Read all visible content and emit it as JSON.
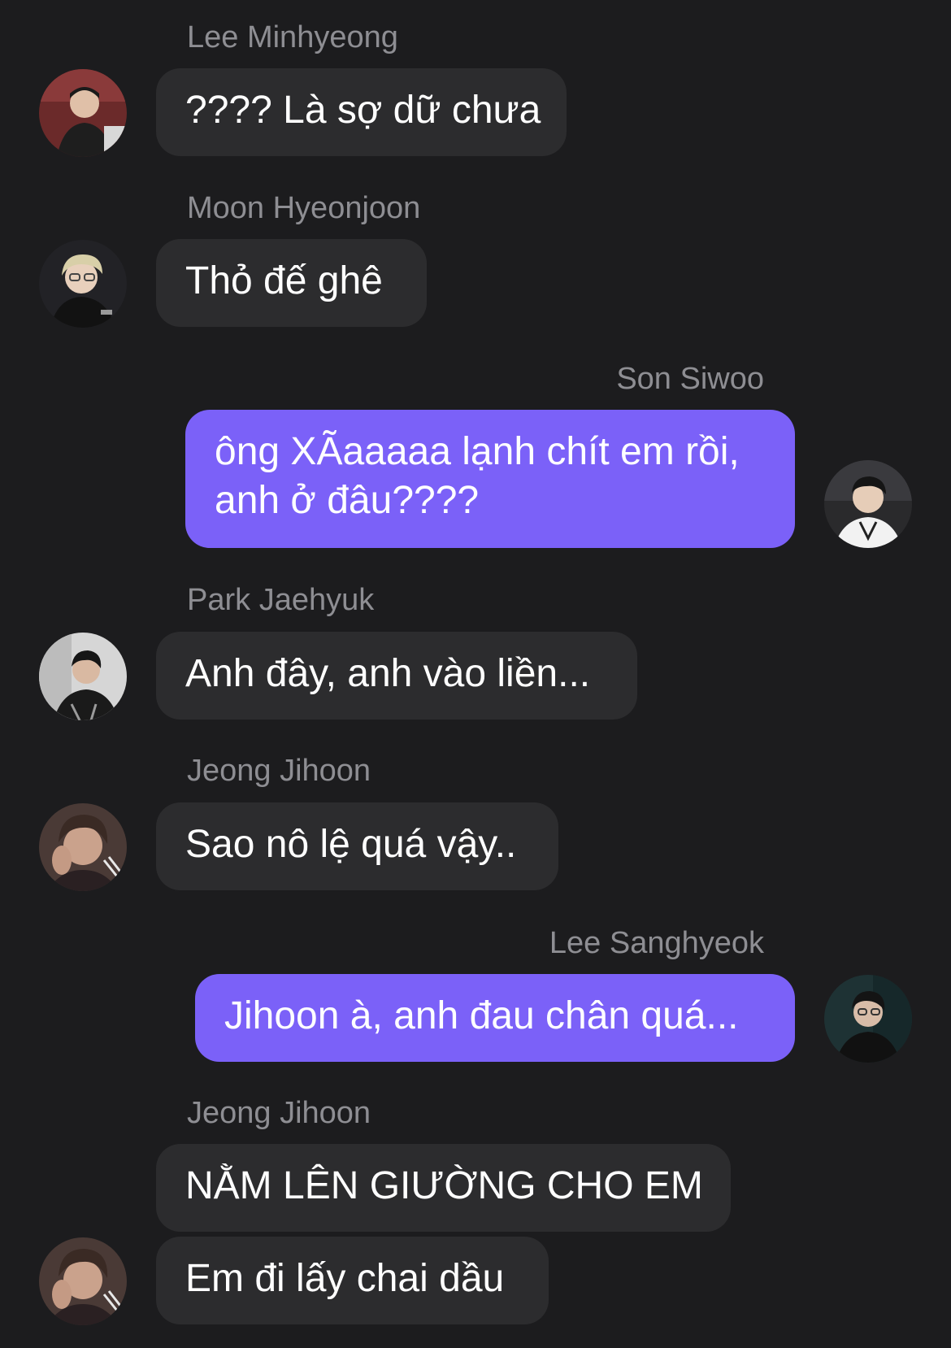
{
  "messages": [
    {
      "sender": "Lee Minhyeong",
      "text": "???? Là sợ dữ chưa"
    },
    {
      "sender": "Moon Hyeonjoon",
      "text": "Thỏ đế ghê"
    },
    {
      "sender": "Son Siwoo",
      "lines": [
        "ông XÃaaaaa lạnh chít em rồi,",
        "anh ở đâu????"
      ]
    },
    {
      "sender": "Park Jaehyuk",
      "text": "Anh đây, anh vào liền..."
    },
    {
      "sender": "Jeong Jihoon",
      "text": "Sao nô lệ quá vậy.."
    },
    {
      "sender": "Lee Sanghyeok",
      "text": "Jihoon à, anh đau chân quá..."
    },
    {
      "sender": "Jeong Jihoon",
      "texts": [
        "NẰM LÊN GIƯỜNG CHO EM",
        "Em đi lấy chai dầu"
      ]
    }
  ],
  "colors": {
    "background": "#1c1c1e",
    "incoming_bubble": "#2c2c2e",
    "outgoing_bubble": "#7b61f8",
    "sender_name": "#8e8e93",
    "message_text": "#ffffff"
  },
  "icons": [
    "avatar-lee-minhyeong",
    "avatar-moon-hyeonjoon",
    "avatar-son-siwoo",
    "avatar-park-jaehyuk",
    "avatar-jeong-jihoon",
    "avatar-lee-sanghyeok"
  ]
}
